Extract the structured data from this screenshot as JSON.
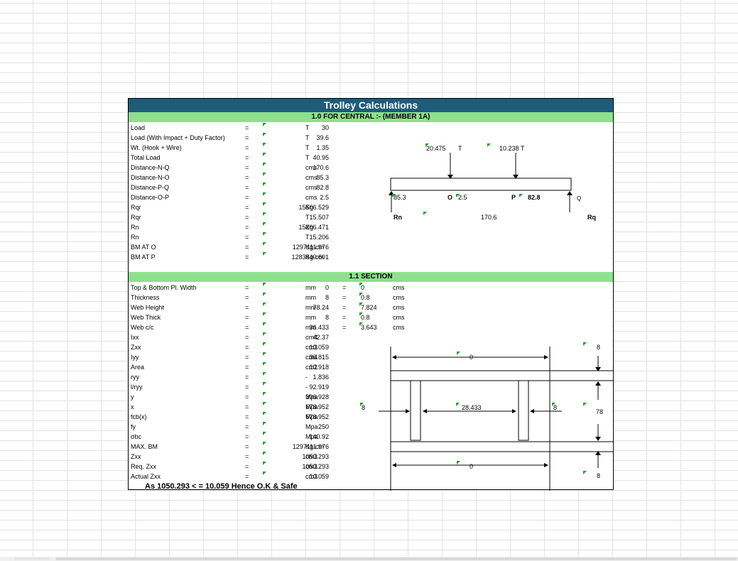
{
  "title": "Trolley Calculations",
  "section1": {
    "header": "1.0 FOR CENTRAL :- (MEMBER 1A)",
    "rows": [
      {
        "label": "Load",
        "value": "30",
        "unit": "T"
      },
      {
        "label": "Load (With Impact + Duty Factor)",
        "value": "39.6",
        "unit": "T"
      },
      {
        "label": "Wt. (Hook + Wire)",
        "value": "1.35",
        "unit": "T"
      },
      {
        "label": "Total Load",
        "value": "40.95",
        "unit": "T"
      },
      {
        "label": "Distance-N-Q",
        "value": "170.6",
        "unit": "cms"
      },
      {
        "label": "Distance-N-O",
        "value": "85.3",
        "unit": "cms"
      },
      {
        "label": "Distance-P-Q",
        "value": "82.8",
        "unit": "cms"
      },
      {
        "label": "Distance-O-P",
        "value": "2.5",
        "unit": "cms"
      },
      {
        "label": "Rqr",
        "value": "15506.529",
        "unit": "Kg"
      },
      {
        "label": "Rqr",
        "value": "15.507",
        "unit": "T"
      },
      {
        "label": "Rn",
        "value": "15206.471",
        "unit": "Kg"
      },
      {
        "label": "Rn",
        "value": "15.206",
        "unit": "T"
      },
      {
        "label": "BM AT O",
        "value": "1297111.976",
        "unit": "Kg-cm"
      },
      {
        "label": "BM AT P",
        "value": "1283940.601",
        "unit": "Kg-cm"
      }
    ]
  },
  "section2": {
    "header": "1.1 SECTION",
    "rows": [
      {
        "label": "Top & Bottom Pl. Width",
        "value": "0",
        "unit": "mm"
      },
      {
        "label": "Thickness",
        "value": "8",
        "unit": "mm"
      },
      {
        "label": "Web Height",
        "value": "78.24",
        "unit": "mm"
      },
      {
        "label": "Web Thick",
        "value": "8",
        "unit": "mm"
      },
      {
        "label": "Web c/c",
        "value": "36.433",
        "unit": "mm"
      },
      {
        "label": "Ixx",
        "value": "42.37",
        "unit": "cm4"
      },
      {
        "label": "Zxx",
        "value": "10.059",
        "unit": "cm3"
      },
      {
        "label": "Iyy",
        "value": "36.815",
        "unit": "cm4"
      },
      {
        "label": "Area",
        "value": "10.918",
        "unit": "cm2"
      },
      {
        "label": "ryy",
        "value": "1.836",
        "unit": "-"
      },
      {
        "label": "l/ryy",
        "value": "92.919",
        "unit": "-"
      },
      {
        "label": "y",
        "value": "306.928",
        "unit": "Mpa"
      },
      {
        "label": "x",
        "value": "678.952",
        "unit": "Mpa"
      },
      {
        "label": "fcb(x)",
        "value": "678.952",
        "unit": "Mpa"
      },
      {
        "label": "fy",
        "value": "250",
        "unit": "Mpa"
      },
      {
        "label": "σbc",
        "value": "140.92",
        "unit": "Mpa"
      },
      {
        "label": "MAX. BM",
        "value": "1297111.976",
        "unit": "Kg-cm"
      },
      {
        "label": "Zxx",
        "value": "1050.293",
        "unit": "cm3"
      },
      {
        "label": "Req. Zxx",
        "value": "1050.293",
        "unit": "cm3"
      },
      {
        "label": "Actual Zxx",
        "value": "10.059",
        "unit": "cm3"
      }
    ],
    "conversions": [
      {
        "value": "0",
        "unit": "cms"
      },
      {
        "value": "0.8",
        "unit": "cms"
      },
      {
        "value": "7.824",
        "unit": "cms"
      },
      {
        "value": "0.8",
        "unit": "cms"
      },
      {
        "value": "3.643",
        "unit": "cms"
      }
    ]
  },
  "eq_sign": "=",
  "result": "As 1050.293 < = 10.059 Hence O.K & Safe",
  "beam_diagram": {
    "load1": "20.475",
    "load1_unit": "T",
    "load2": "10.238",
    "load2_unit": "T",
    "dist_no": "85.3",
    "label_o": "O",
    "dist_op": "2.5",
    "label_p": "P",
    "dist_pq": "82.8",
    "label_q": "Q",
    "label_rn": "Rn",
    "span": "170.6",
    "label_rq": "Rq"
  },
  "section_diagram": {
    "top_width": "0",
    "top_thick": "8",
    "web_thick_left": "8",
    "web_cc": "28.433",
    "web_thick_right": "8",
    "web_height": "78",
    "bottom_width": "0",
    "bottom_thick": "8"
  },
  "colors": {
    "title_bg": "#1e5c7a",
    "section_bg": "#8ee08e",
    "comment_marker": "#1aa31a"
  }
}
